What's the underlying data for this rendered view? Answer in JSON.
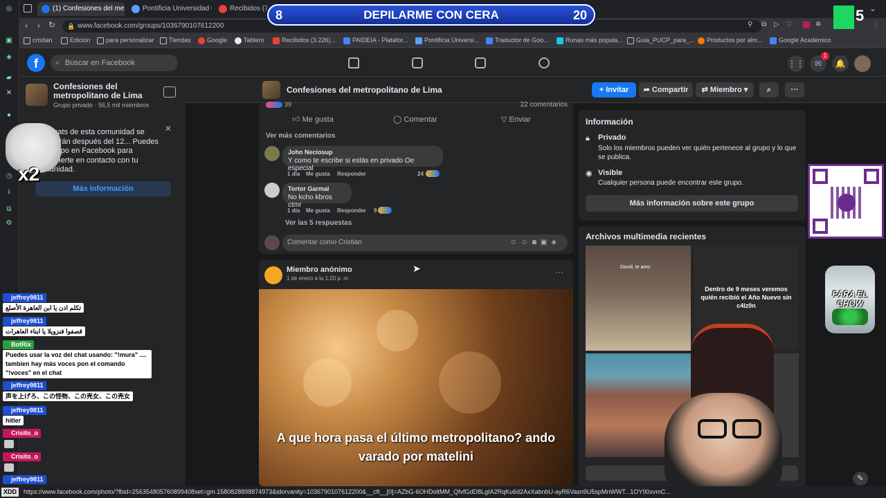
{
  "browser": {
    "tabs": [
      {
        "label": "(1) Confesiones del metro",
        "color": "#1877f2"
      },
      {
        "label": "Pontificia Universidad Cat",
        "color": "#5aa0ff"
      },
      {
        "label": "Recibidos (7.50",
        "color": "#ea4335"
      }
    ],
    "url": "www.facebook.com/groups/1036790107612200",
    "bookmarks": [
      {
        "label": "cristian",
        "color": "#8ab4f8"
      },
      {
        "label": "Edicion",
        "color": "#8ab4f8"
      },
      {
        "label": "para personalizar",
        "color": "#8ab4f8"
      },
      {
        "label": "Tiendas",
        "color": "#8ab4f8"
      },
      {
        "label": "Google",
        "color": "#ea4335"
      },
      {
        "label": "Tablero",
        "color": "#e8eaed"
      },
      {
        "label": "Recibidos (3.226)...",
        "color": "#ea4335"
      },
      {
        "label": "PAIDEIA - Platafor...",
        "color": "#4285f4"
      },
      {
        "label": "Pontificia Universi...",
        "color": "#5aa0ff"
      },
      {
        "label": "Traductor de Goo...",
        "color": "#4285f4"
      },
      {
        "label": "Runas más popula...",
        "color": "#1ec4f0"
      },
      {
        "label": "Guia_PUCP_para_...",
        "color": "#e8eaed"
      },
      {
        "label": "Productos por alm...",
        "color": "#f57c00"
      },
      {
        "label": "Google Académico",
        "color": "#4285f4"
      }
    ],
    "status_url": "https://www.facebook.com/photo/?fbid=256354805760899408set=gm.1580828898874973&idorvanity=1036790107612200&__cft__[0]=AZbG-6OHDoltMM_QfvfGdD8LgIA2RqKu6d2AxXabnbU-ayR6Vasn9U5spMnWWT...1OY90xvmC..."
  },
  "overlay": {
    "banner_left_num": "8",
    "banner_title": "DEPILARME CON CERA",
    "banner_right_num": "20",
    "k_count": "5",
    "x2": "x2",
    "yape_jar_text": "PARA EL CHOW",
    "xdd": "XDD"
  },
  "fb": {
    "search_placeholder": "Buscar en Facebook",
    "messenger_badge": "1",
    "group_name": "Confesiones del metropolitano de Lima",
    "group_meta": "Grupo privado · 56,5 mil miembros",
    "notice_text": "Los chats de esta comunidad se eliminarán después del 12... Puedes ir al grupo en Facebook para mantenerte en contacto con tu comunidad.",
    "notice_button": "Más información",
    "invite": "Invitar",
    "share": "Compartir",
    "member": "Miembro",
    "reactions_count": "39",
    "comments_count": "22 comentarios",
    "like": "Me gusta",
    "comment": "Comentar",
    "send": "Enviar",
    "more_comments": "Ver más comentarios",
    "comments": [
      {
        "name": "John Neciosup",
        "text": "Y como te escribe si estás en privado Oe especial",
        "time": "1 día",
        "like": "Me gusta",
        "reply": "Responder",
        "reactions": "24"
      },
      {
        "name": "Tortor Garmal",
        "text": "No kcho kbros ctmr",
        "time": "1 día",
        "like": "Me gusta",
        "reply": "Responder",
        "reactions": "9"
      }
    ],
    "see_replies": "Ver las 5 respuestas",
    "comment_as": "Comentar como Cristian",
    "post_author": "Miembro anónimo",
    "post_date": "1 de enero a la 1:20 p. m. ·",
    "post_caption": "A que hora pasa el último metropolitano? ando varado por matelini",
    "info_title": "Información",
    "private_title": "Privado",
    "private_desc": "Solo los miembros pueden ver quién pertenece al grupo y lo que se publica.",
    "visible_title": "Visible",
    "visible_desc": "Cualquier persona puede encontrar este grupo.",
    "more_info_group": "Más información sobre este grupo",
    "media_title": "Archivos multimedia recientes",
    "media_text": "Dentro de 9 meses veremos quién recibió el Año Nuevo sin c4lz0n",
    "media_small": "David, te amo"
  },
  "chat": [
    {
      "user": "jeffrey9811",
      "msg": "تكلم اذن يا ابن العاهرة الأصلع",
      "color": "#1e4fd0"
    },
    {
      "user": "jeffrey9811",
      "msg": "قصفوا فنزويلا يا ابناء العاهرات",
      "color": "#1e4fd0"
    },
    {
      "user": "BotRix",
      "msg": "Puedes usar la voz del chat usando: \"!mura\" .... tambien hay más voces pon el comando \"!voces\" en el chat",
      "color": "#2e9e3c"
    },
    {
      "user": "jeffrey9811",
      "msg": "声を上げろ、この怪物、この売女、この売女",
      "color": "#1e4fd0"
    },
    {
      "user": "jeffrey9811",
      "msg": "hitler",
      "color": "#1e4fd0"
    },
    {
      "user": "Crisito_o",
      "msg": "",
      "color": "#c2185b"
    },
    {
      "user": "Crisito_o",
      "msg": "",
      "color": "#c2185b"
    },
    {
      "user": "jeffrey9811",
      "msg": "",
      "color": "#1e4fd0"
    }
  ]
}
